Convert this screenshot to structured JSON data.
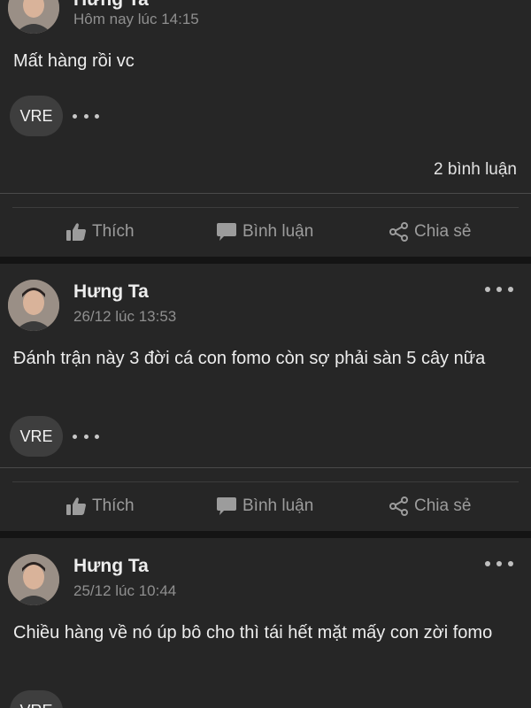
{
  "posts": [
    {
      "author": "Hưng Ta",
      "timestamp": "Hôm nay lúc 14:15",
      "content": "Mất hàng rồi vc",
      "tag": "VRE",
      "comment_count": "2 bình luận"
    },
    {
      "author": "Hưng Ta",
      "timestamp": "26/12 lúc 13:53",
      "content": "Đánh trận này 3 đời cá con fomo còn sợ phải sàn 5 cây nữa",
      "tag": "VRE"
    },
    {
      "author": "Hưng Ta",
      "timestamp": "25/12 lúc 10:44",
      "content": "Chiều hàng về nó úp bô cho thì tái hết mặt mấy con zời fomo",
      "tag": "VRE"
    }
  ],
  "actions": {
    "like": "Thích",
    "comment": "Bình luận",
    "share": "Chia sẻ"
  },
  "icons": {
    "like": "thumbs-up-icon",
    "comment": "speech-bubble-icon",
    "share": "share-icon",
    "more": "more-horizontal-icon"
  },
  "colors": {
    "background": "#141414",
    "card": "#262626",
    "text": "#ededed",
    "muted": "#8f8f8f",
    "action": "#9c9c9c"
  }
}
